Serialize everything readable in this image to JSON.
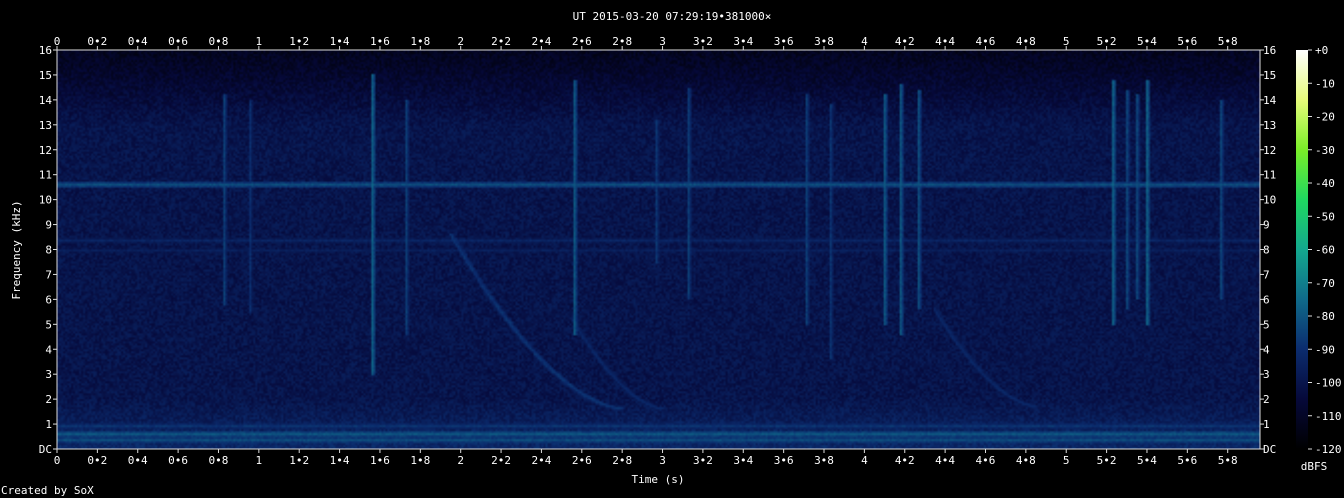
{
  "chart_data": {
    "type": "heatmap",
    "title": "UT 2015-03-20 07:29:19•381000×",
    "xlabel": "Time (s)",
    "ylabel": "Frequency (kHz)",
    "xlim": [
      0,
      5.96
    ],
    "ylim": [
      0,
      16
    ],
    "x_ticks": [
      "0",
      "0•2",
      "0•4",
      "0•6",
      "0•8",
      "1",
      "1•2",
      "1•4",
      "1•6",
      "1•8",
      "2",
      "2•2",
      "2•4",
      "2•6",
      "2•8",
      "3",
      "3•2",
      "3•4",
      "3•6",
      "3•8",
      "4",
      "4•2",
      "4•4",
      "4•6",
      "4•8",
      "5",
      "5•2",
      "5•4",
      "5•6",
      "5•8"
    ],
    "y_ticks": [
      "DC",
      "1",
      "2",
      "3",
      "4",
      "5",
      "6",
      "7",
      "8",
      "9",
      "10",
      "11",
      "12",
      "13",
      "14",
      "15",
      "16"
    ],
    "colorbar": {
      "label": "dBFS",
      "range": [
        -120,
        0
      ],
      "ticks": [
        "+0",
        "-10",
        "-20",
        "-30",
        "-40",
        "-50",
        "-60",
        "-70",
        "-80",
        "-90",
        "-100",
        "-110",
        "-120"
      ],
      "colors": [
        "#000000",
        "#06093a",
        "#0b2c6e",
        "#0f6a8a",
        "#13a88e",
        "#1fd860",
        "#7aee28",
        "#e6fb7a",
        "#ffffff"
      ]
    },
    "background_dbfs": -100,
    "features": [
      {
        "kind": "tone",
        "freq_khz": 10.6,
        "level_dbfs": -82
      },
      {
        "kind": "tone",
        "freq_khz": 8.4,
        "level_dbfs": -93
      },
      {
        "kind": "tone",
        "freq_khz": 8.0,
        "level_dbfs": -95
      },
      {
        "kind": "tone",
        "freq_khz": 0.6,
        "level_dbfs": -80
      },
      {
        "kind": "tone",
        "freq_khz": 0.3,
        "level_dbfs": -82
      },
      {
        "kind": "tone",
        "freq_khz": 0.9,
        "level_dbfs": -88
      },
      {
        "kind": "sweep",
        "t_start": 1.95,
        "f_start_khz": 8.6,
        "t_end": 2.8,
        "f_end_khz": 1.6,
        "level_dbfs": -90
      },
      {
        "kind": "sweep",
        "t_start": 2.55,
        "f_start_khz": 5.2,
        "t_end": 3.0,
        "f_end_khz": 1.6,
        "level_dbfs": -94
      },
      {
        "kind": "sweep",
        "t_start": 4.35,
        "f_start_khz": 5.6,
        "t_end": 4.85,
        "f_end_khz": 1.7,
        "level_dbfs": -94
      },
      {
        "kind": "spike",
        "t": 0.82,
        "f_low_khz": 5.8,
        "f_high_khz": 14.2,
        "level_dbfs": -86
      },
      {
        "kind": "spike",
        "t": 0.95,
        "f_low_khz": 5.5,
        "f_high_khz": 14.0,
        "level_dbfs": -90
      },
      {
        "kind": "spike",
        "t": 1.56,
        "f_low_khz": 3.0,
        "f_high_khz": 15.0,
        "level_dbfs": -78
      },
      {
        "kind": "spike",
        "t": 1.73,
        "f_low_khz": 4.6,
        "f_high_khz": 14.0,
        "level_dbfs": -86
      },
      {
        "kind": "spike",
        "t": 2.56,
        "f_low_khz": 4.6,
        "f_high_khz": 14.8,
        "level_dbfs": -80
      },
      {
        "kind": "spike",
        "t": 2.97,
        "f_low_khz": 7.5,
        "f_high_khz": 13.2,
        "level_dbfs": -88
      },
      {
        "kind": "spike",
        "t": 3.13,
        "f_low_khz": 6.0,
        "f_high_khz": 14.5,
        "level_dbfs": -86
      },
      {
        "kind": "spike",
        "t": 3.72,
        "f_low_khz": 5.0,
        "f_high_khz": 14.2,
        "level_dbfs": -86
      },
      {
        "kind": "spike",
        "t": 3.83,
        "f_low_khz": 3.6,
        "f_high_khz": 13.8,
        "level_dbfs": -88
      },
      {
        "kind": "spike",
        "t": 4.1,
        "f_low_khz": 5.0,
        "f_high_khz": 14.2,
        "level_dbfs": -80
      },
      {
        "kind": "spike",
        "t": 4.18,
        "f_low_khz": 4.6,
        "f_high_khz": 14.6,
        "level_dbfs": -80
      },
      {
        "kind": "spike",
        "t": 4.27,
        "f_low_khz": 5.6,
        "f_high_khz": 14.4,
        "level_dbfs": -82
      },
      {
        "kind": "spike",
        "t": 5.23,
        "f_low_khz": 5.0,
        "f_high_khz": 14.8,
        "level_dbfs": -78
      },
      {
        "kind": "spike",
        "t": 5.3,
        "f_low_khz": 5.6,
        "f_high_khz": 14.4,
        "level_dbfs": -84
      },
      {
        "kind": "spike",
        "t": 5.35,
        "f_low_khz": 6.0,
        "f_high_khz": 14.2,
        "level_dbfs": -84
      },
      {
        "kind": "spike",
        "t": 5.4,
        "f_low_khz": 5.0,
        "f_high_khz": 14.8,
        "level_dbfs": -78
      },
      {
        "kind": "spike",
        "t": 5.77,
        "f_low_khz": 6.0,
        "f_high_khz": 14.0,
        "level_dbfs": -84
      }
    ],
    "grid": false,
    "legend": "colorbar-right"
  },
  "footer": {
    "credit": "Created by SoX"
  }
}
